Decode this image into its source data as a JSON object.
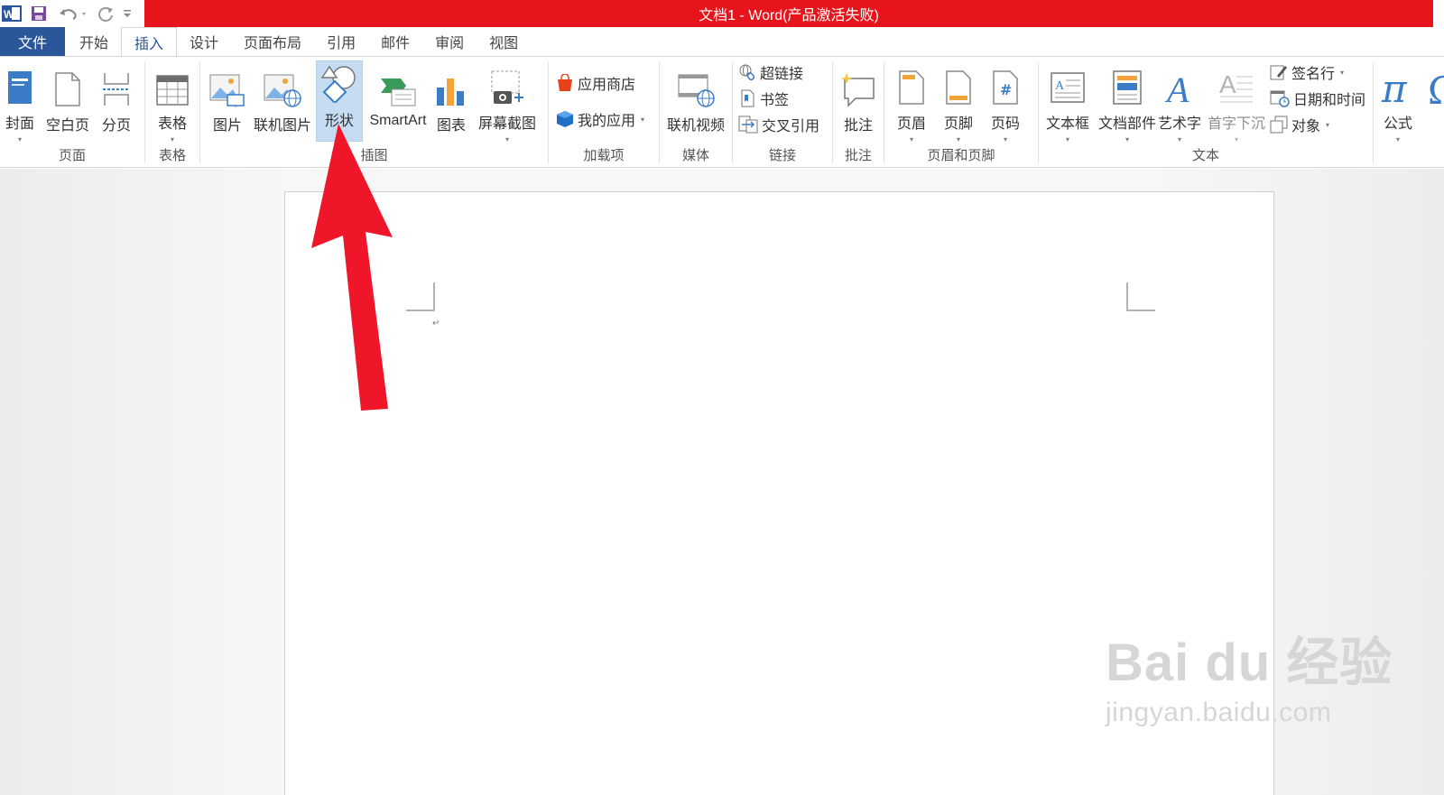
{
  "window": {
    "title": "文档1 -  Word(产品激活失败)"
  },
  "tabs": [
    {
      "label": "文件"
    },
    {
      "label": "开始"
    },
    {
      "label": "插入"
    },
    {
      "label": "设计"
    },
    {
      "label": "页面布局"
    },
    {
      "label": "引用"
    },
    {
      "label": "邮件"
    },
    {
      "label": "审阅"
    },
    {
      "label": "视图"
    }
  ],
  "ribbon": {
    "groups": {
      "pages": {
        "label": "页面",
        "buttons": [
          "封面",
          "空白页",
          "分页"
        ]
      },
      "tables": {
        "label": "表格",
        "buttons": [
          "表格"
        ]
      },
      "illustrations": {
        "label": "插图",
        "buttons": [
          "图片",
          "联机图片",
          "形状",
          "SmartArt",
          "图表",
          "屏幕截图"
        ]
      },
      "addins": {
        "label": "加载项",
        "buttons": [
          "应用商店",
          "我的应用"
        ]
      },
      "media": {
        "label": "媒体",
        "buttons": [
          "联机视频"
        ]
      },
      "links": {
        "label": "链接",
        "buttons": [
          "超链接",
          "书签",
          "交叉引用"
        ]
      },
      "comments": {
        "label": "批注",
        "buttons": [
          "批注"
        ]
      },
      "headerfooter": {
        "label": "页眉和页脚",
        "buttons": [
          "页眉",
          "页脚",
          "页码"
        ]
      },
      "text": {
        "label": "文本",
        "buttons": [
          "文本框",
          "文档部件",
          "艺术字",
          "首字下沉",
          "签名行",
          "日期和时间",
          "对象"
        ]
      },
      "symbols": {
        "buttons": [
          "公式"
        ]
      }
    }
  },
  "document": {
    "paragraph_mark": "↵"
  },
  "watermark": {
    "brand": "Bai du 经验",
    "url": "jingyan.baidu.com"
  },
  "colors": {
    "title_band": "#e8141c",
    "file_tab": "#2b579a",
    "selected_button": "#c5dcf3",
    "arrow": "#f0162a"
  }
}
